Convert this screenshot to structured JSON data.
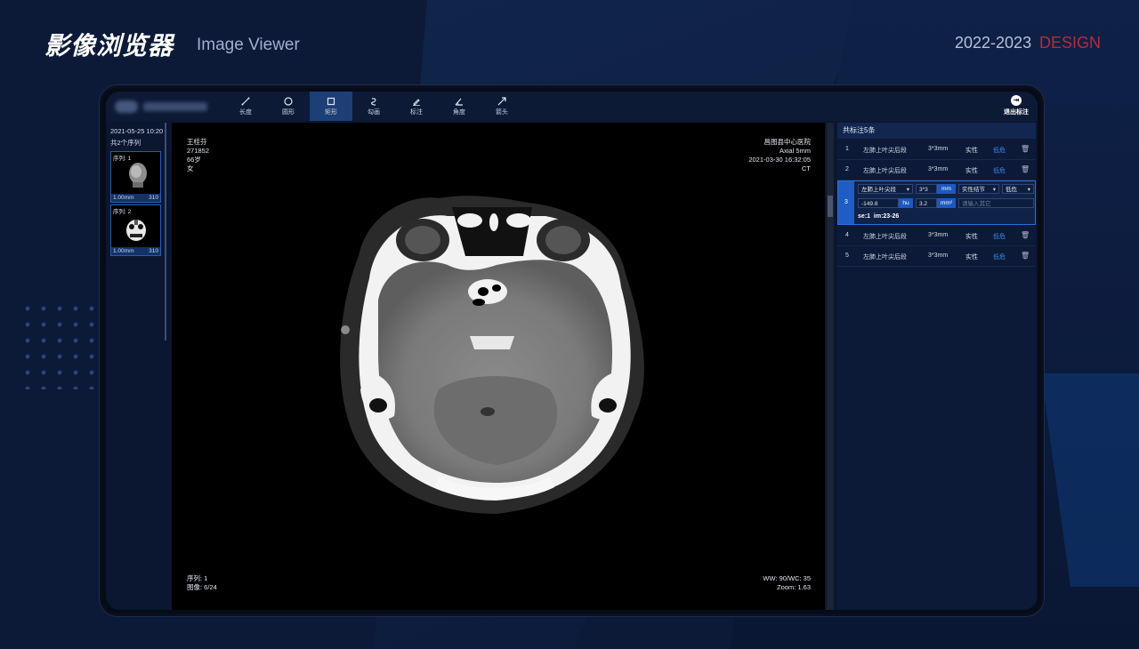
{
  "header": {
    "title": "影像浏览器",
    "subtitle": "Image Viewer",
    "year": "2022-2023",
    "design": "DESIGN"
  },
  "toolbar": {
    "tools": [
      {
        "label": "长度",
        "icon": "ruler-line-icon"
      },
      {
        "label": "圆形",
        "icon": "circle-icon"
      },
      {
        "label": "矩形",
        "icon": "rectangle-icon",
        "active": true
      },
      {
        "label": "勾画",
        "icon": "freehand-icon"
      },
      {
        "label": "标注",
        "icon": "pencil-icon"
      },
      {
        "label": "角度",
        "icon": "angle-icon"
      },
      {
        "label": "箭头",
        "icon": "arrow-icon"
      }
    ],
    "exit_label": "退出标注"
  },
  "series_panel": {
    "date": "2021-05-25  10:20",
    "count": "共2个序列",
    "series": [
      {
        "label": "序列: 1",
        "thickness": "1.00mm",
        "images": "310"
      },
      {
        "label": "序列: 2",
        "thickness": "1.00mm",
        "images": "310"
      }
    ]
  },
  "viewer": {
    "patient_name": "王桂芬",
    "patient_id": "271852",
    "age": "66岁",
    "sex": "女",
    "hospital": "昌图县中心医院",
    "slice_info": "Axial 5mm",
    "study_time": "2021-03-30  16:32:05",
    "modality": "CT",
    "series_no": "序列: 1",
    "image_no": "图像: 6/24",
    "window": "WW: 90/WC: 35",
    "zoom": "Zoom: 1.63"
  },
  "annotations": {
    "header": "共标注5条",
    "rows": [
      {
        "no": "1",
        "location": "左肺上叶尖后段",
        "size": "3*3mm",
        "type": "实性",
        "risk": "低危"
      },
      {
        "no": "2",
        "location": "左肺上叶尖后段",
        "size": "3*3mm",
        "type": "实性",
        "risk": "低危"
      },
      {
        "no": "4",
        "location": "左肺上叶尖后段",
        "size": "3*3mm",
        "type": "实性",
        "risk": "低危"
      },
      {
        "no": "5",
        "location": "左肺上叶尖后段",
        "size": "3*3mm",
        "type": "实性",
        "risk": "低危"
      }
    ],
    "editing": {
      "no": "3",
      "location": "左肺上叶尖段",
      "size": "3*3",
      "size_unit": "mm",
      "type": "实性结节",
      "risk": "低危",
      "density": "-149.8",
      "density_unit": "hu",
      "area": "3.2",
      "area_unit": "mm²",
      "other_placeholder": "请输入其它",
      "se": "se:1",
      "im": "im:23-26"
    }
  },
  "colors": {
    "accent": "#1f5dc4",
    "design_red": "#b72a3a",
    "risk_blue": "#3d86e6"
  }
}
